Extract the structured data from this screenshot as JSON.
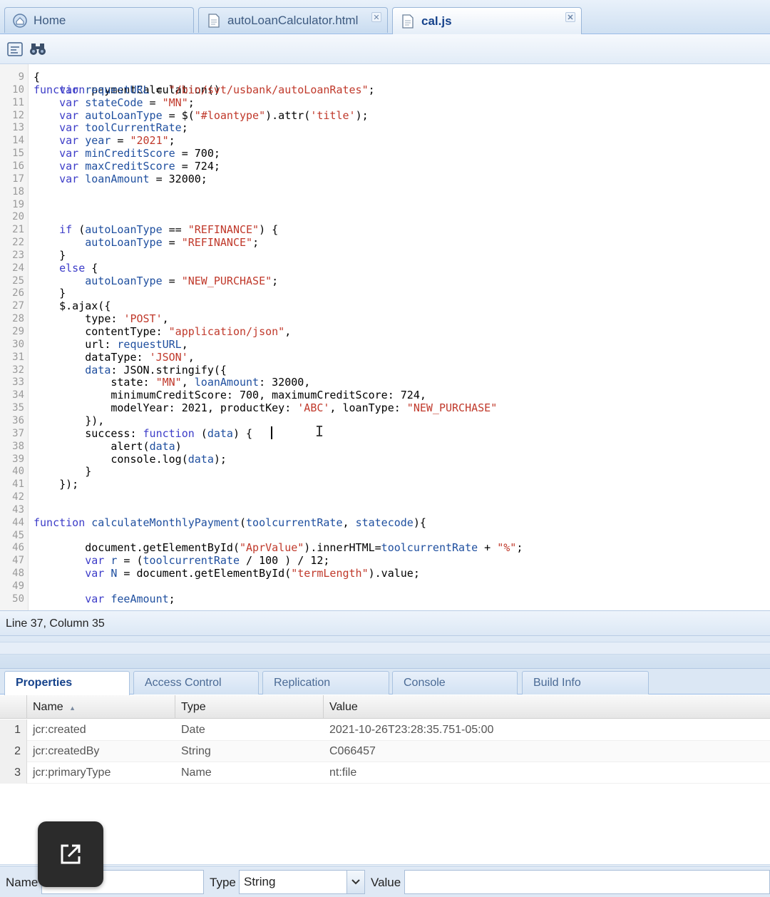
{
  "tabs": [
    {
      "label": "Home",
      "icon": "home-icon",
      "active": false
    },
    {
      "label": "autoLoanCalculator.html",
      "icon": "file-icon",
      "active": false
    },
    {
      "label": "cal.js",
      "icon": "file-icon",
      "active": true
    }
  ],
  "toolbar": {
    "icons": [
      "format-code-icon",
      "find-binoculars-icon"
    ]
  },
  "editor": {
    "partial_line": "function paymentCalculation()",
    "lines": [
      {
        "n": "9",
        "code": "{"
      },
      {
        "n": "10",
        "code": "    var requestURL = \"/bin/svt/usbank/autoLoanRates\";"
      },
      {
        "n": "11",
        "code": "    var stateCode = \"MN\";"
      },
      {
        "n": "12",
        "code": "    var autoLoanType = $(\"#loantype\").attr('title');"
      },
      {
        "n": "13",
        "code": "    var toolCurrentRate;"
      },
      {
        "n": "14",
        "code": "    var year = \"2021\";"
      },
      {
        "n": "15",
        "code": "    var minCreditScore = 700;"
      },
      {
        "n": "16",
        "code": "    var maxCreditScore = 724;"
      },
      {
        "n": "17",
        "code": "    var loanAmount = 32000;"
      },
      {
        "n": "18",
        "code": ""
      },
      {
        "n": "19",
        "code": ""
      },
      {
        "n": "20",
        "code": ""
      },
      {
        "n": "21",
        "code": "    if (autoLoanType == \"REFINANCE\") {"
      },
      {
        "n": "22",
        "code": "        autoLoanType = \"REFINANCE\";"
      },
      {
        "n": "23",
        "code": "    }"
      },
      {
        "n": "24",
        "code": "    else {"
      },
      {
        "n": "25",
        "code": "        autoLoanType = \"NEW_PURCHASE\";"
      },
      {
        "n": "26",
        "code": "    }"
      },
      {
        "n": "27",
        "code": "    $.ajax({"
      },
      {
        "n": "28",
        "code": "        type: 'POST',"
      },
      {
        "n": "29",
        "code": "        contentType: \"application/json\","
      },
      {
        "n": "30",
        "code": "        url: requestURL,"
      },
      {
        "n": "31",
        "code": "        dataType: 'JSON',"
      },
      {
        "n": "32",
        "code": "        data: JSON.stringify({"
      },
      {
        "n": "33",
        "code": "            state: \"MN\", loanAmount: 32000,"
      },
      {
        "n": "34",
        "code": "            minimumCreditScore: 700, maximumCreditScore: 724,"
      },
      {
        "n": "35",
        "code": "            modelYear: 2021, productKey: 'ABC', loanType: \"NEW_PURCHASE\""
      },
      {
        "n": "36",
        "code": "        }),"
      },
      {
        "n": "37",
        "code": "        success: function (data) {"
      },
      {
        "n": "38",
        "code": "            alert(data)"
      },
      {
        "n": "39",
        "code": "            console.log(data);"
      },
      {
        "n": "40",
        "code": "        }"
      },
      {
        "n": "41",
        "code": "    });"
      },
      {
        "n": "42",
        "code": ""
      },
      {
        "n": "43",
        "code": ""
      },
      {
        "n": "44",
        "code": "function calculateMonthlyPayment(toolcurrentRate, statecode){"
      },
      {
        "n": "45",
        "code": ""
      },
      {
        "n": "46",
        "code": "        document.getElementById(\"AprValue\").innerHTML=toolcurrentRate + \"%\";"
      },
      {
        "n": "47",
        "code": "        var r = (toolcurrentRate / 100 ) / 12;"
      },
      {
        "n": "48",
        "code": "        var N = document.getElementById(\"termLength\").value;"
      },
      {
        "n": "49",
        "code": ""
      },
      {
        "n": "50",
        "code": "        var feeAmount;"
      }
    ]
  },
  "status": {
    "cursor_position": "Line 37, Column 35"
  },
  "panel_tabs": [
    {
      "label": "Properties",
      "active": true
    },
    {
      "label": "Access Control",
      "active": false
    },
    {
      "label": "Replication",
      "active": false
    },
    {
      "label": "Console",
      "active": false
    },
    {
      "label": "Build Info",
      "active": false
    }
  ],
  "grid": {
    "columns": [
      "Name",
      "Type",
      "Value"
    ],
    "sort_indicator": "▲",
    "rows": [
      {
        "num": "1",
        "name": "jcr:created",
        "type": "Date",
        "value": "2021-10-26T23:28:35.751-05:00"
      },
      {
        "num": "2",
        "name": "jcr:createdBy",
        "type": "String",
        "value": "C066457"
      },
      {
        "num": "3",
        "name": "jcr:primaryType",
        "type": "Name",
        "value": "nt:file"
      }
    ]
  },
  "form": {
    "name_label": "Name",
    "name_value": "",
    "type_label": "Type",
    "type_value": "String",
    "value_label": "Value",
    "value_value": ""
  },
  "overlay": {
    "icon": "open-external-icon"
  },
  "colors": {
    "accent": "#15428b",
    "keyword": "#3c3cc8",
    "string": "#c0392b",
    "identifier": "#1f4f9f"
  }
}
